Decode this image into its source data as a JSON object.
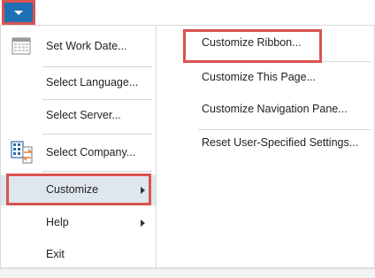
{
  "left_menu": {
    "items": [
      {
        "label": "Set Work Date...",
        "icon": "calendar-icon"
      },
      {
        "label": "Select Language..."
      },
      {
        "label": "Select Server..."
      },
      {
        "label": "Select Company...",
        "icon": "company-switch-icon"
      },
      {
        "label": "Customize",
        "selected": true
      },
      {
        "label": "Help"
      },
      {
        "label": "Exit"
      }
    ]
  },
  "right_menu": {
    "items": [
      {
        "label": "Customize Ribbon..."
      },
      {
        "label": "Customize This Page..."
      },
      {
        "label": "Customize Navigation Pane..."
      },
      {
        "label": "Reset User-Specified Settings..."
      }
    ]
  },
  "colors": {
    "app_button": "#1f6fb5",
    "highlight": "#d9534f",
    "selected_bg": "#dfe7ee"
  }
}
